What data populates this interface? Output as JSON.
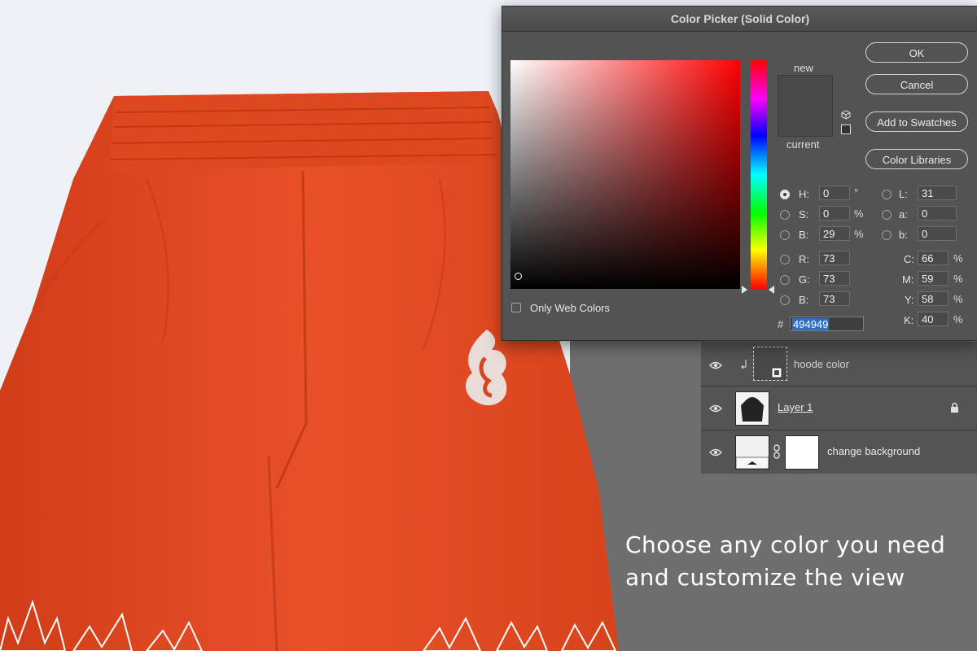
{
  "dialog": {
    "title": "Color Picker (Solid Color)",
    "new_label": "new",
    "current_label": "current",
    "swatch_color": "#494949",
    "buttons": {
      "ok": "OK",
      "cancel": "Cancel",
      "add_to_swatches": "Add to Swatches",
      "color_libraries": "Color Libraries"
    },
    "hsb": {
      "h": {
        "label": "H:",
        "value": "0",
        "unit": "°",
        "selected": true
      },
      "s": {
        "label": "S:",
        "value": "0",
        "unit": "%"
      },
      "b": {
        "label": "B:",
        "value": "29",
        "unit": "%"
      }
    },
    "rgb": {
      "r": {
        "label": "R:",
        "value": "73"
      },
      "g": {
        "label": "G:",
        "value": "73"
      },
      "b": {
        "label": "B:",
        "value": "73"
      }
    },
    "lab": {
      "l": {
        "label": "L:",
        "value": "31"
      },
      "a": {
        "label": "a:",
        "value": "0"
      },
      "b": {
        "label": "b:",
        "value": "0"
      }
    },
    "cmyk": {
      "c": {
        "label": "C:",
        "value": "66",
        "unit": "%"
      },
      "m": {
        "label": "M:",
        "value": "59",
        "unit": "%"
      },
      "y": {
        "label": "Y:",
        "value": "58",
        "unit": "%"
      },
      "k": {
        "label": "K:",
        "value": "40",
        "unit": "%"
      }
    },
    "only_web_colors": "Only Web Colors",
    "hash": "#",
    "hex_value": "494949"
  },
  "layers": [
    {
      "name": "hoode color"
    },
    {
      "name": "Layer 1"
    },
    {
      "name": "change background"
    }
  ],
  "caption": {
    "line1": "Choose any color you need",
    "line2": "and customize the view"
  },
  "colors": {
    "shorts": "#e4461f",
    "panel_bg": "#6e6e6e",
    "dialog_bg": "#535353"
  }
}
